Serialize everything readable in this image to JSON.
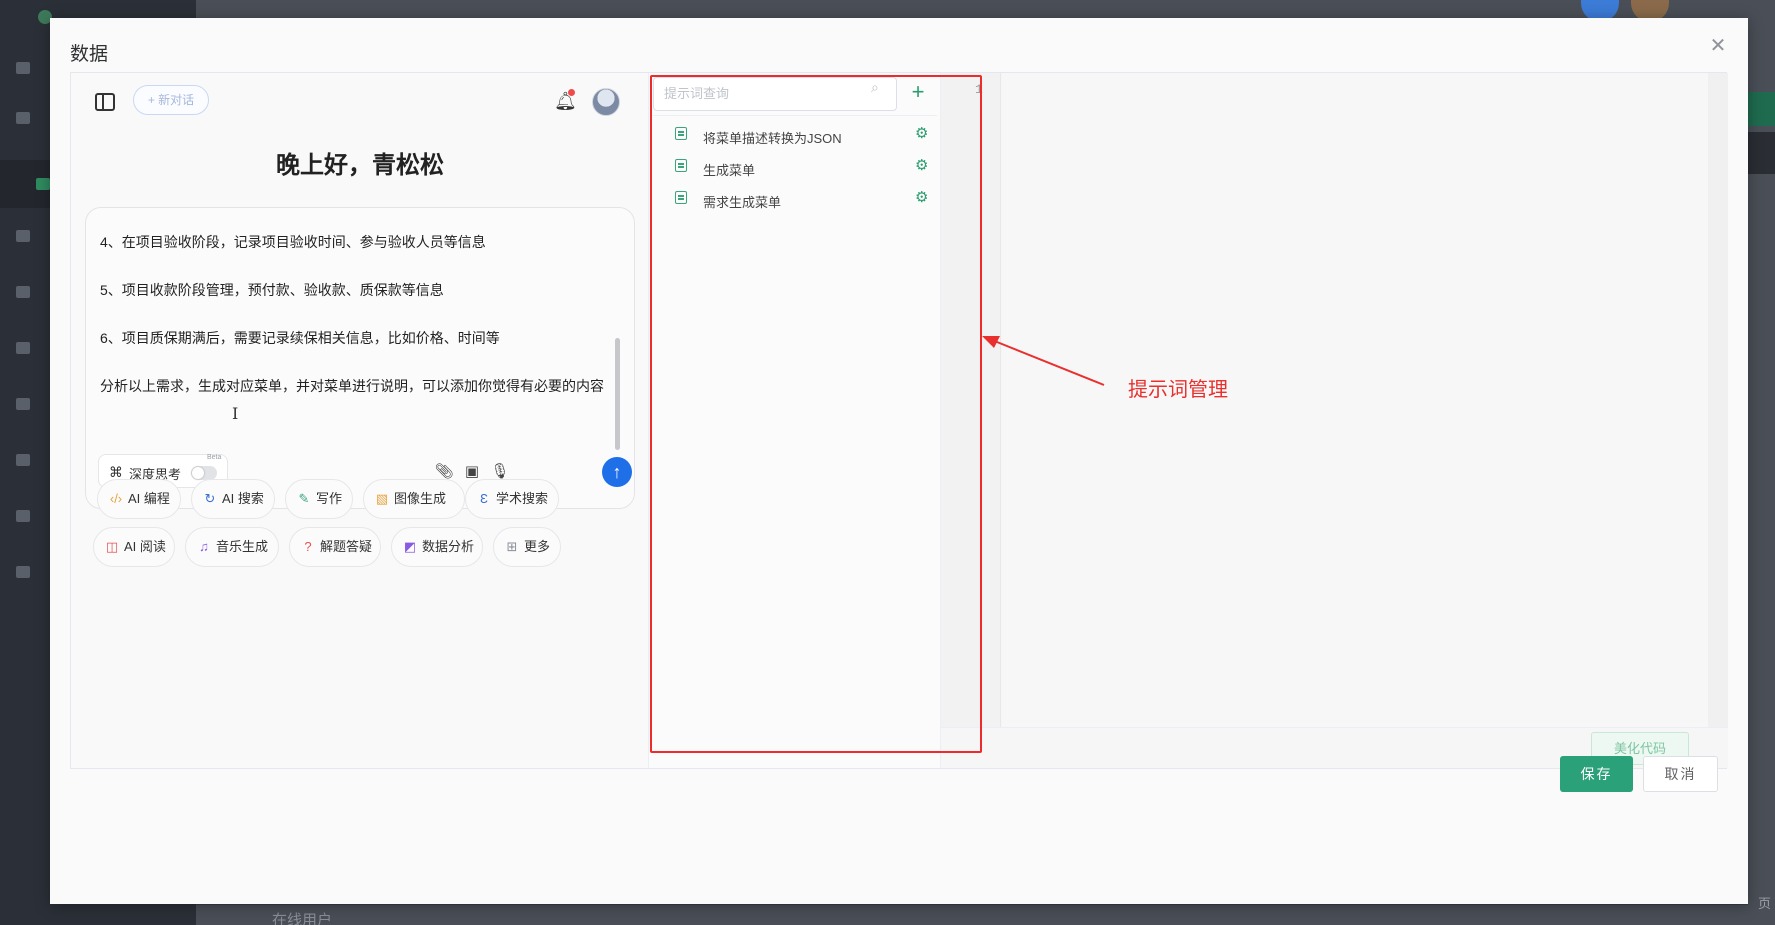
{
  "background_app": {
    "bottom_text": "在线用户",
    "page_text": "页"
  },
  "dialog": {
    "title": "数据",
    "close_icon": "close-icon"
  },
  "chat": {
    "new_chat_label": "+ 新对话",
    "greeting": "晚上好，青松松",
    "message_lines": [
      "4、在项目验收阶段，记录项目验收时间、参与验收人员等信息",
      "5、项目收款阶段管理，预付款、验收款、质保款等信息",
      "6、项目质保期满后，需要记录续保相关信息，比如价格、时间等",
      "分析以上需求，生成对应菜单，并对菜单进行说明，可以添加你觉得有必要的内容"
    ],
    "deep_think_label": "深度思考",
    "deep_think_badge": "Beta",
    "chips": [
      {
        "label": "AI 编程",
        "icon": "code-icon",
        "color": "#e8a23a"
      },
      {
        "label": "AI 搜索",
        "icon": "search-icon",
        "color": "#3b6fd8"
      },
      {
        "label": "写作",
        "icon": "pen-icon",
        "color": "#3aa57a"
      },
      {
        "label": "图像生成",
        "icon": "image-icon",
        "color": "#e8a23a"
      },
      {
        "label": "学术搜索",
        "icon": "academic-icon",
        "color": "#3b6fd8"
      },
      {
        "label": "AI 阅读",
        "icon": "book-icon",
        "color": "#e55353"
      },
      {
        "label": "音乐生成",
        "icon": "music-icon",
        "color": "#8a5be0"
      },
      {
        "label": "解题答疑",
        "icon": "question-icon",
        "color": "#e55353"
      },
      {
        "label": "数据分析",
        "icon": "chart-icon",
        "color": "#8a5be0"
      },
      {
        "label": "更多",
        "icon": "grid-icon",
        "color": "#8a8f97"
      }
    ]
  },
  "prompts": {
    "search_placeholder": "提示词查询",
    "items": [
      {
        "label": "将菜单描述转换为JSON"
      },
      {
        "label": "生成菜单"
      },
      {
        "label": "需求生成菜单"
      }
    ]
  },
  "editor": {
    "line_number": "1",
    "beautify_label": "美化代码"
  },
  "annotation": {
    "label": "提示词管理",
    "color": "#e8302e"
  },
  "footer": {
    "save_label": "保存",
    "cancel_label": "取消"
  },
  "colors": {
    "accent": "#2aa178",
    "send": "#1e6fe8"
  }
}
